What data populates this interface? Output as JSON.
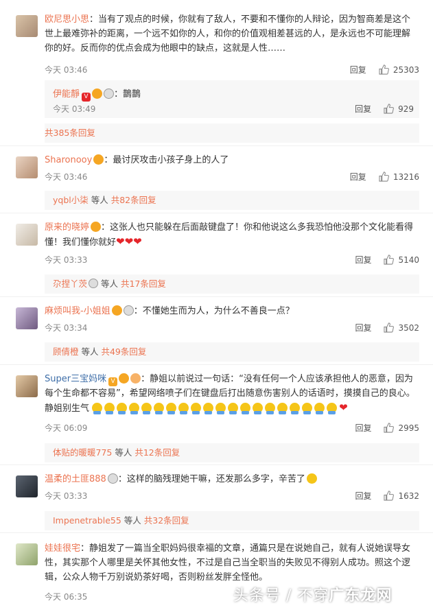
{
  "comments": [
    {
      "user": "欧尼思小思",
      "text": "当有了观点的时候，你就有了敌人，不要和不懂你的人辩论，因为智商差是这个世上最难弥补的距离，一个远不如你的人，和你的价值观相差甚远的人，是永远也不可能理解你的好。反而你的优点会成为他眼中的缺点，这就是人性……",
      "time": "今天 03:46",
      "reply": "回复",
      "likes": "25303",
      "sub": {
        "user": "伊能靜",
        "text": "鵲鵲",
        "time": "今天 03:49",
        "reply": "回复",
        "likes": "929"
      },
      "more": {
        "who": "",
        "mid": "",
        "count": "共385条回复"
      }
    },
    {
      "user": "Sharonooy",
      "text": "最讨厌攻击小孩子身上的人了",
      "time": "今天 03:46",
      "reply": "回复",
      "likes": "13216",
      "more": {
        "who": "yqbl小柒",
        "mid": " 等人 ",
        "count": "共82条回复"
      }
    },
    {
      "user": "原来的晓婷",
      "text": "这张人也只能躲在后面敲键盘了！你和他说这么多我恐怕他没那个文化能看得懂！我们懂你就好",
      "time": "今天 03:33",
      "reply": "回复",
      "likes": "5140",
      "more": {
        "who": "尕捏丫茨",
        "mid": " 等人 ",
        "count": "共17条回复"
      }
    },
    {
      "user": "麻烦叫我-小姐姐",
      "text": "不懂她生而为人，为什么不善良一点？",
      "time": "今天 03:34",
      "reply": "回复",
      "likes": "3502",
      "more": {
        "who": "顾倩橙",
        "mid": " 等人 ",
        "count": "共49条回复"
      }
    },
    {
      "user": "Super三宝妈咪",
      "text": "静姐以前说过一句话：“没有任何一个人应该承担他人的恶意，因为每个生命都不容易”，希望网络喷子们在键盘后打出随意伤害别人的话语时，摸摸自己的良心。静姐别生气",
      "time": "今天 06:09",
      "reply": "回复",
      "likes": "2995",
      "more": {
        "who": "体贴的暖暖775",
        "mid": " 等人 ",
        "count": "共12条回复"
      }
    },
    {
      "user": "温柔的土匪888",
      "text": "这样的脑残理她干嘛，还发那么多字，辛苦了",
      "time": "今天 03:33",
      "reply": "回复",
      "likes": "1632",
      "more": {
        "who": "Impenetrable55",
        "mid": " 等人 ",
        "count": "共32条回复"
      }
    },
    {
      "user": "娃娃很宅",
      "text": "静姐发了一篇当全职妈妈很幸福的文章，通篇只是在说她自己，就有人说她误导女性，其实那个人哪里是关怀其他女性，不过是自己当全职当的失败见不得别人成功。照这个逻辑，公众人物千万别说奶茶好喝，否则粉丝发胖全怪他。",
      "time": "今天 06:35",
      "reply": "",
      "likes": ""
    }
  ],
  "watermark": {
    "left": "头条号 / 不穿",
    "right": "广东龙网"
  },
  "colors": {
    "username": "#eb7350",
    "link": "#eb7350",
    "text": "#333333",
    "meta": "#888888"
  }
}
